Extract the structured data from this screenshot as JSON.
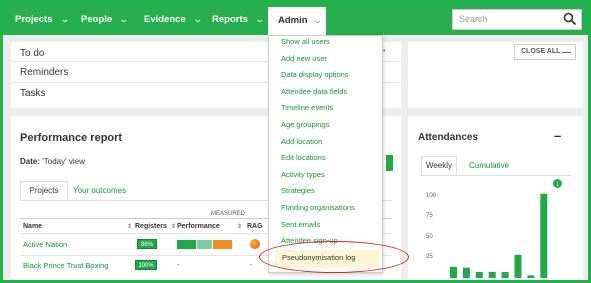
{
  "nav": {
    "items": [
      {
        "label": "Projects"
      },
      {
        "label": "People"
      },
      {
        "label": "Evidence"
      },
      {
        "label": "Reports"
      }
    ],
    "admin_label": "Admin",
    "search_placeholder": "Search"
  },
  "todo_card": {
    "rows": [
      "To do",
      "Reminders",
      "Tasks"
    ]
  },
  "close_all_label": "CLOSE ALL",
  "admin_menu": {
    "items": [
      "Show all users",
      "Add new user",
      "Data display options",
      "Attendee data fields",
      "Timeline events",
      "Age groupings",
      "Add location",
      "Edit locations",
      "Activity types",
      "Strategies",
      "Funding organisations",
      "Sent emails",
      "Attendee sign-up",
      "Pseudonymisation log"
    ],
    "highlighted": "Pseudonymisation log"
  },
  "performance": {
    "title": "Performance report",
    "date_label": "Date:",
    "date_value": "'Today' view",
    "tabs": [
      "Projects",
      "Your outcomes"
    ],
    "measured_label": "MEASURED",
    "columns": [
      "Name",
      "Registers",
      "Performance",
      "RAG"
    ],
    "rows": [
      {
        "name": "Active Nation",
        "registers": "86%",
        "performance": [
          {
            "color": "#22a84a",
            "fraction": 0.3
          },
          {
            "color": "#7fce99",
            "fraction": 0.25
          },
          {
            "color": "#f08a24",
            "fraction": 0.3
          }
        ],
        "rag": "amber-red"
      },
      {
        "name": "Black Prince Trust Boxing",
        "registers": "100%",
        "performance": [],
        "rag": ""
      }
    ],
    "dash": "-"
  },
  "attendances": {
    "title": "Attendances",
    "tabs": [
      "Weekly",
      "Cumulative"
    ],
    "chart_data": {
      "type": "bar",
      "y_ticks": [
        "100",
        "75",
        "50",
        "25"
      ],
      "ylim": [
        0,
        110
      ],
      "values": [
        13,
        12,
        7,
        7,
        7,
        27,
        3,
        98
      ],
      "bar_color": "#22a84a"
    }
  },
  "colors": {
    "brand_green": "#27ae4f",
    "link_green": "#1d8f3a",
    "annotation_red": "#d9261c"
  }
}
